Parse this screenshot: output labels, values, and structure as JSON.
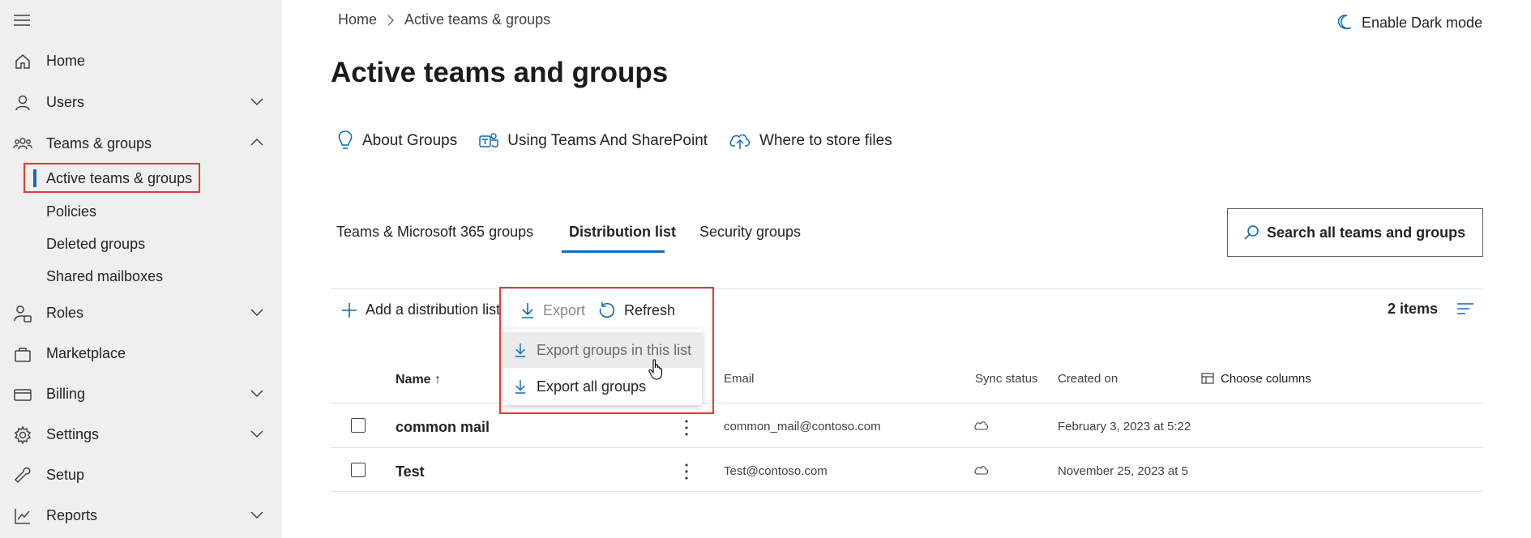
{
  "sidebar": {
    "items": [
      {
        "label": "Home",
        "icon": "home-icon"
      },
      {
        "label": "Users",
        "icon": "user-icon",
        "chevron": "down"
      },
      {
        "label": "Teams & groups",
        "icon": "teams-icon",
        "chevron": "up"
      },
      {
        "label": "Roles",
        "icon": "roles-icon",
        "chevron": "down"
      },
      {
        "label": "Marketplace",
        "icon": "marketplace-icon"
      },
      {
        "label": "Billing",
        "icon": "billing-icon",
        "chevron": "down"
      },
      {
        "label": "Settings",
        "icon": "gear-icon",
        "chevron": "down"
      },
      {
        "label": "Setup",
        "icon": "wrench-icon"
      },
      {
        "label": "Reports",
        "icon": "reports-icon",
        "chevron": "down"
      }
    ],
    "sub_items": [
      "Active teams & groups",
      "Policies",
      "Deleted groups",
      "Shared mailboxes"
    ]
  },
  "breadcrumb": {
    "home": "Home",
    "current": "Active teams & groups"
  },
  "header": {
    "dark_mode_label": "Enable Dark mode"
  },
  "page_title": "Active teams and groups",
  "links": [
    "About Groups",
    "Using Teams And SharePoint",
    "Where to store files"
  ],
  "tabs": [
    "Teams & Microsoft 365 groups",
    "Distribution list",
    "Security groups"
  ],
  "active_tab": "Distribution list",
  "search": {
    "label": "Search all teams and groups"
  },
  "toolbar": {
    "add_label": "Add a distribution list",
    "export_label": "Export",
    "refresh_label": "Refresh",
    "items_count": "2 items"
  },
  "export_menu": [
    "Export groups in this list",
    "Export all groups"
  ],
  "table": {
    "columns": {
      "name": "Name",
      "email": "Email",
      "sync": "Sync status",
      "created": "Created on",
      "choose": "Choose columns"
    },
    "rows": [
      {
        "name": "common mail",
        "email": "common_mail@contoso.com",
        "created": "February 3, 2023 at 5:22"
      },
      {
        "name": "Test",
        "email": "Test@contoso.com",
        "created": "November 25, 2023 at 5"
      }
    ]
  },
  "colors": {
    "accent": "#0f6cbd",
    "highlight": "#e53935",
    "sidebar_bg": "#efefef"
  }
}
